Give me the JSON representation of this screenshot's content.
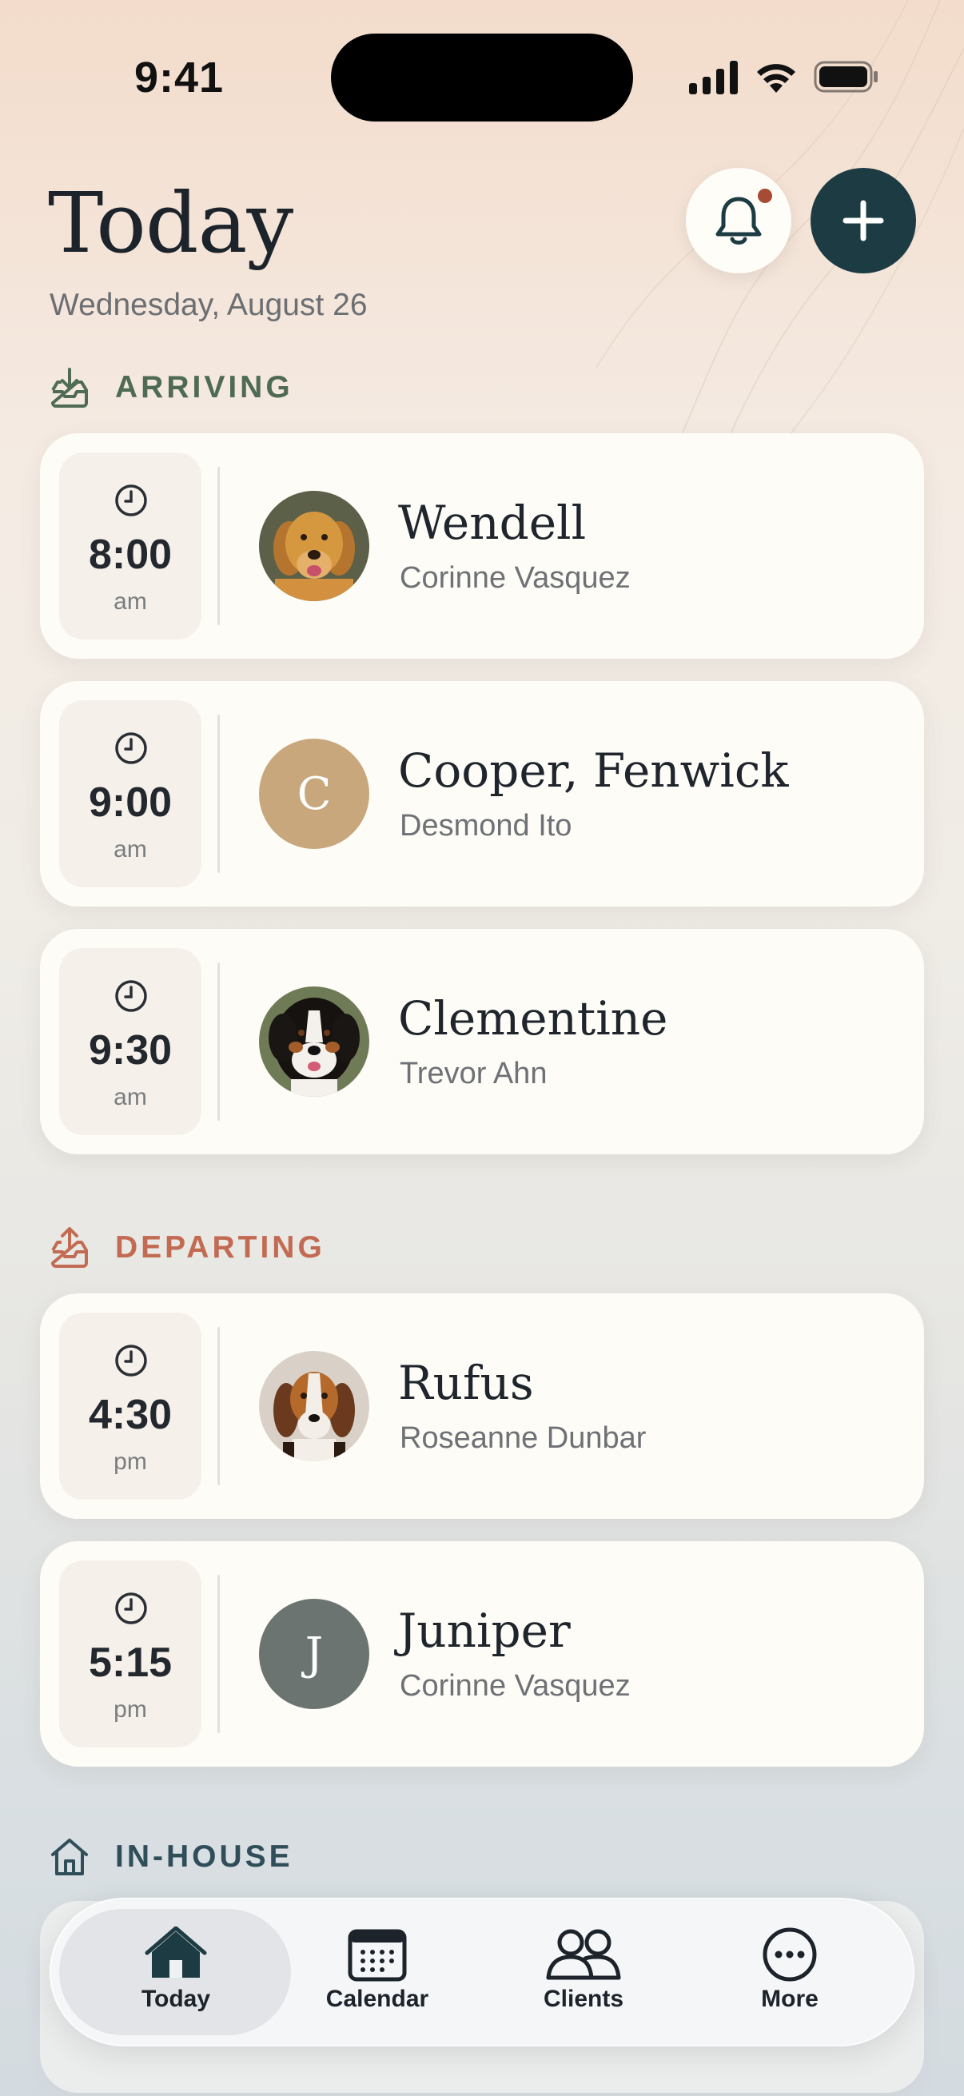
{
  "status_bar": {
    "time": "9:41"
  },
  "header": {
    "title": "Today",
    "date": "Wednesday, August 26"
  },
  "sections": {
    "arriving": {
      "label": "ARRIVING",
      "cards": [
        {
          "time": "8:00",
          "ampm": "am",
          "pet": "Wendell",
          "owner": "Corinne Vasquez",
          "avatar": "golden-retriever-photo"
        },
        {
          "time": "9:00",
          "ampm": "am",
          "pet": "Cooper, Fenwick",
          "owner": "Desmond Ito",
          "avatar_initial": "C",
          "avatar_color": "#c9a77c"
        },
        {
          "time": "9:30",
          "ampm": "am",
          "pet": "Clementine",
          "owner": "Trevor Ahn",
          "avatar": "bernese-mountain-dog-photo"
        }
      ]
    },
    "departing": {
      "label": "DEPARTING",
      "cards": [
        {
          "time": "4:30",
          "ampm": "pm",
          "pet": "Rufus",
          "owner": "Roseanne Dunbar",
          "avatar": "beagle-photo"
        },
        {
          "time": "5:15",
          "ampm": "pm",
          "pet": "Juniper",
          "owner": "Corinne Vasquez",
          "avatar_initial": "J",
          "avatar_color": "#6b7470"
        }
      ]
    },
    "in_house": {
      "label": "IN-HOUSE"
    }
  },
  "colors": {
    "arriving": "#4f6b53",
    "departing": "#c26b52",
    "in_house": "#2f4e5a",
    "primary_button": "#1d3b43",
    "notification_dot": "#a64b34"
  },
  "tabbar": {
    "items": [
      {
        "label": "Today",
        "icon": "home-icon",
        "active": true
      },
      {
        "label": "Calendar",
        "icon": "calendar-icon",
        "active": false
      },
      {
        "label": "Clients",
        "icon": "clients-icon",
        "active": false
      },
      {
        "label": "More",
        "icon": "more-icon",
        "active": false
      }
    ]
  }
}
